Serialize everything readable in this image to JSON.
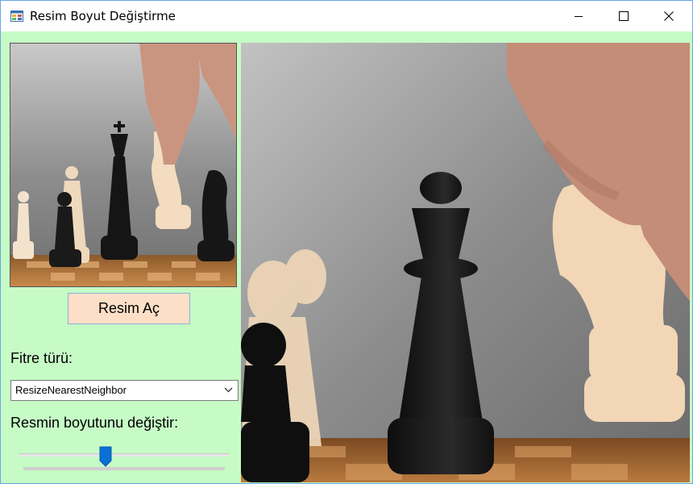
{
  "window": {
    "title": "Resim Boyut Değiştirme",
    "icon": "app-form-icon",
    "controls": [
      "minimize-icon",
      "maximize-icon",
      "close-icon"
    ]
  },
  "open_button": {
    "label": "Resim Aç"
  },
  "filter": {
    "label": "Fitre türü:",
    "selected": "ResizeNearestNeighbor"
  },
  "resize": {
    "label": "Resmin boyutunu değiştir:",
    "slider_value_fraction": 0.4
  },
  "colors": {
    "background": "#c6fbc6",
    "button_bg": "#fddfc7",
    "slider_thumb": "#0b6fd6"
  }
}
